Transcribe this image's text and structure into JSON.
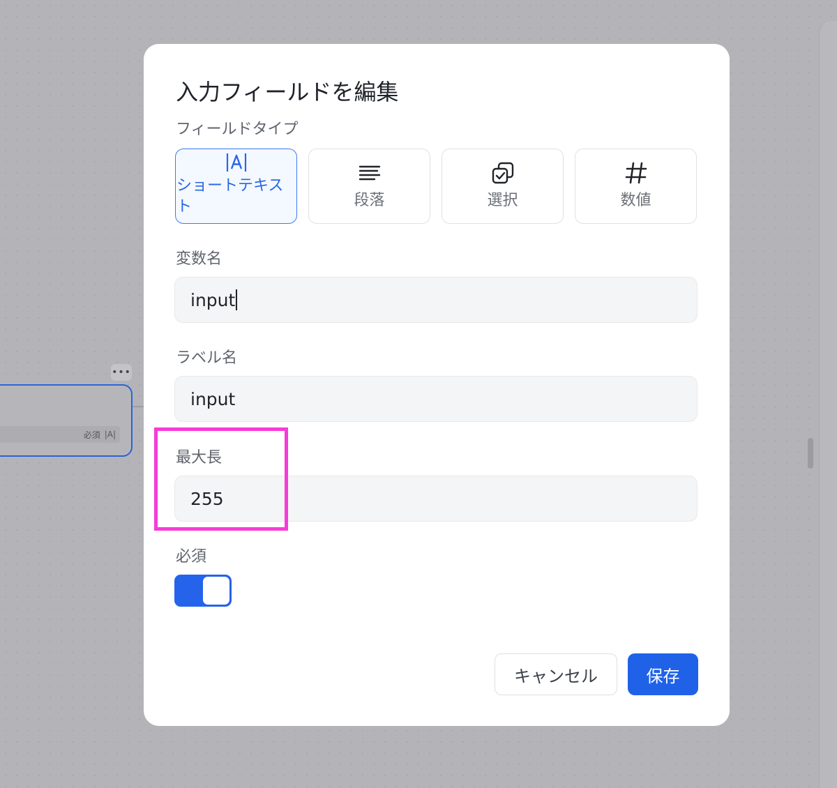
{
  "background": {
    "node_required_text": "必須",
    "node_type_glyph": "|A|",
    "node_more": "•••"
  },
  "dialog": {
    "title": "入力フィールドを編集",
    "field_type_label": "フィールドタイプ",
    "types": [
      {
        "label": "ショートテキスト",
        "icon": "text-cursor-icon",
        "selected": true
      },
      {
        "label": "段落",
        "icon": "paragraph-icon",
        "selected": false
      },
      {
        "label": "選択",
        "icon": "select-checkbox-icon",
        "selected": false
      },
      {
        "label": "数値",
        "icon": "hash-icon",
        "selected": false
      }
    ],
    "variable_name_label": "変数名",
    "variable_name_value": "input",
    "label_name_label": "ラベル名",
    "label_name_value": "input",
    "max_length_label": "最大長",
    "max_length_value": "255",
    "required_label": "必須",
    "required_on": true,
    "cancel_label": "キャンセル",
    "save_label": "保存"
  },
  "colors": {
    "accent": "#1f62e8",
    "highlight": "#f83bd8"
  }
}
